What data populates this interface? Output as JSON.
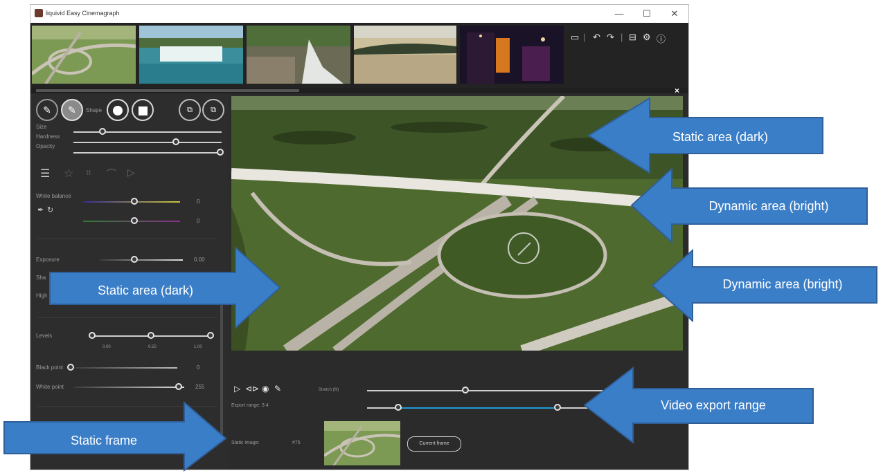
{
  "window": {
    "title": "liquivid Easy Cinemagraph",
    "controls": {
      "minimize": "—",
      "maximize": "☐",
      "close": "✕"
    }
  },
  "toolbar_icons": [
    "folder-icon",
    "undo-icon",
    "redo-icon",
    "export-icon",
    "settings-icon",
    "info-icon"
  ],
  "brush": {
    "shape_label": "Shape",
    "size_label": "Size",
    "hardness_label": "Hardness",
    "opacity_label": "Opacity",
    "size": 0.2,
    "hardness": 0.72,
    "opacity": 1.0
  },
  "adjustments": {
    "white_balance_label": "White balance",
    "wb_value1": "0",
    "wb_value2": "0",
    "exposure_label": "Exposure",
    "exposure_value": "0.00",
    "shadows_label_partial": "Sha",
    "highlights_label_partial": "High",
    "levels_label": "Levels",
    "levels_values": [
      "0.00",
      "0.50",
      "1.00"
    ],
    "black_point_label": "Black point",
    "black_point_value": "0",
    "white_point_label": "White point",
    "white_point_value": "255"
  },
  "playback": {
    "speed_label": "Stretch (fit)",
    "export_range_label": "Export range: 3  4",
    "static_image_label": "Static image:",
    "static_frame_number": "#75",
    "current_frame_button": "Current frame"
  },
  "annotations": {
    "static_top": "Static area (dark)",
    "dynamic_1": "Dynamic area (bright)",
    "dynamic_2": "Dynamic area (bright)",
    "static_left": "Static area (dark)",
    "export_range": "Video export range",
    "static_frame": "Static frame"
  },
  "colors": {
    "accent": "#1e9bd7",
    "arrow_fill": "#3b7ec8",
    "arrow_stroke": "#2f5f99"
  }
}
